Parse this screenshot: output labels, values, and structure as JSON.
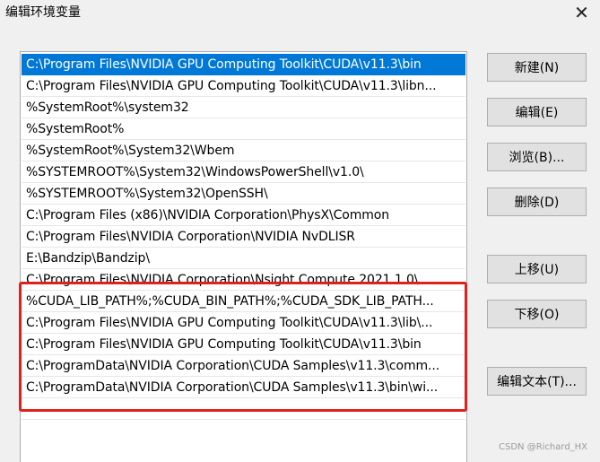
{
  "window": {
    "title": "编辑环境变量",
    "close_glyph": "✕",
    "close_icon": "close-icon"
  },
  "list": {
    "items": [
      "C:\\Program Files\\NVIDIA GPU Computing Toolkit\\CUDA\\v11.3\\bin",
      "C:\\Program Files\\NVIDIA GPU Computing Toolkit\\CUDA\\v11.3\\libn...",
      "%SystemRoot%\\system32",
      "%SystemRoot%",
      "%SystemRoot%\\System32\\Wbem",
      "%SYSTEMROOT%\\System32\\WindowsPowerShell\\v1.0\\",
      "%SYSTEMROOT%\\System32\\OpenSSH\\",
      "C:\\Program Files (x86)\\NVIDIA Corporation\\PhysX\\Common",
      "C:\\Program Files\\NVIDIA Corporation\\NVIDIA NvDLISR",
      "E:\\Bandzip\\Bandzip\\",
      "C:\\Program Files\\NVIDIA Corporation\\Nsight Compute 2021.1.0\\",
      "%CUDA_LIB_PATH%;%CUDA_BIN_PATH%;%CUDA_SDK_LIB_PATH...",
      "C:\\Program Files\\NVIDIA GPU Computing Toolkit\\CUDA\\v11.3\\lib\\...",
      "C:\\Program Files\\NVIDIA GPU Computing Toolkit\\CUDA\\v11.3\\bin",
      "C:\\ProgramData\\NVIDIA Corporation\\CUDA Samples\\v11.3\\comm...",
      "C:\\ProgramData\\NVIDIA Corporation\\CUDA Samples\\v11.3\\bin\\wi..."
    ],
    "selected_index": 0,
    "selection_color": "#0078d7",
    "highlight_color": "#e0201c"
  },
  "buttons": {
    "new": "新建(N)",
    "edit": "编辑(E)",
    "browse": "浏览(B)...",
    "delete": "删除(D)",
    "move_up": "上移(U)",
    "move_down": "下移(O)",
    "edit_text": "编辑文本(T)..."
  },
  "watermark": "CSDN @Richard_HX"
}
